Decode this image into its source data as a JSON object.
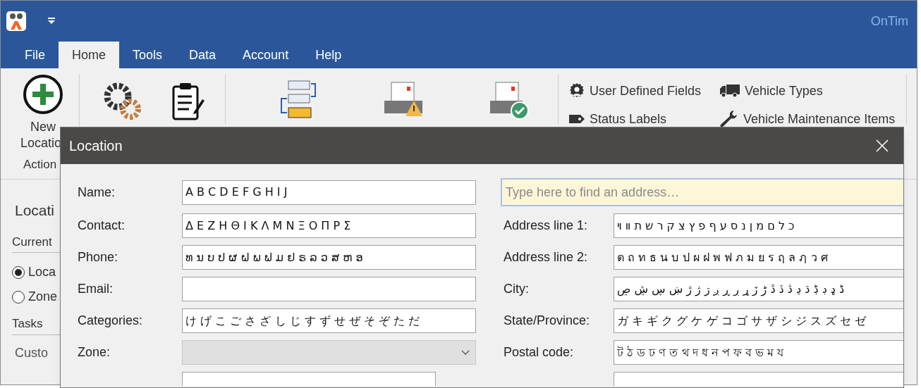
{
  "app": {
    "title": "OnTim"
  },
  "menu_tabs": [
    {
      "label": "File",
      "selected": false
    },
    {
      "label": "Home",
      "selected": true
    },
    {
      "label": "Tools",
      "selected": false
    },
    {
      "label": "Data",
      "selected": false
    },
    {
      "label": "Account",
      "selected": false
    },
    {
      "label": "Help",
      "selected": false
    }
  ],
  "ribbon": {
    "new_button": {
      "line_1": "New",
      "line_2": "Locatio"
    },
    "group_label": "Action",
    "small_items": [
      {
        "label": "User Defined Fields",
        "kind": "user"
      },
      {
        "label": "Vehicle Types",
        "kind": "truck"
      },
      {
        "label": "Status Labels",
        "kind": "tag"
      },
      {
        "label": "Vehicle Maintenance Items",
        "kind": "wrench"
      }
    ]
  },
  "side_panel": {
    "title": "Locati",
    "section": "Current",
    "radios": [
      {
        "label": "Loca",
        "selected": true
      },
      {
        "label": "Zone",
        "selected": false
      }
    ],
    "tasks_heading": "Tasks",
    "tasks": [
      "Custo"
    ]
  },
  "dialog": {
    "title": "Location",
    "search": {
      "placeholder": "Type here to find an address…"
    },
    "left_fields": [
      {
        "label": "Name:",
        "kind": "text",
        "value": "A B C D E F G H I J"
      },
      {
        "label": "Contact:",
        "kind": "text",
        "value": "Δ Ε Ζ Η Θ Ι Κ Λ Μ Ν Ξ Ο Π Ρ Σ"
      },
      {
        "label": "Phone:",
        "kind": "text",
        "value": "ທ ນ ບ ປ ຜ ຝ ພ ຟ ມ ຢ ຣ ລ ວ ສ ຫ ອ"
      },
      {
        "label": "Email:",
        "kind": "text"
      },
      {
        "label": "Categories:",
        "kind": "text",
        "value": "け げ こ ご さ ざ し じ す ず せ ぜ そ ぞ た だ"
      },
      {
        "label": "Zone:",
        "kind": "dropdown",
        "disabled": true
      }
    ],
    "right_fields": [
      {
        "label": "Address line 1:",
        "value": "כ ל ם מ ן נ ס ע ף פ ץ צ ק ר ש ת װ ױ"
      },
      {
        "label": "Address line 2:",
        "value": "ต ถ ท ธ น บ ป ผ ฝ พ ฟ ภ ม ย ร ฤ ล ฦ ว ศ"
      },
      {
        "label": "City:",
        "value": "ڈ ډ ڊ ڋ ڌ ڍ ڎ ڏ ڐ ڑ ڒ ړ ڔ ڕ ږ ڗ ژ ڙ ښ ڛ ڜ ڝ"
      },
      {
        "label": "State/Province:",
        "value": "ガ キ ギ ク グ ケ ゲ コ ゴ サ ザ シ ジ ス ズ セ ゼ"
      },
      {
        "label": "Postal code:",
        "value": "ট ঠ ড ঢ ণ ত থ দ ধ ন প ফ ব ভ ম য"
      }
    ]
  }
}
